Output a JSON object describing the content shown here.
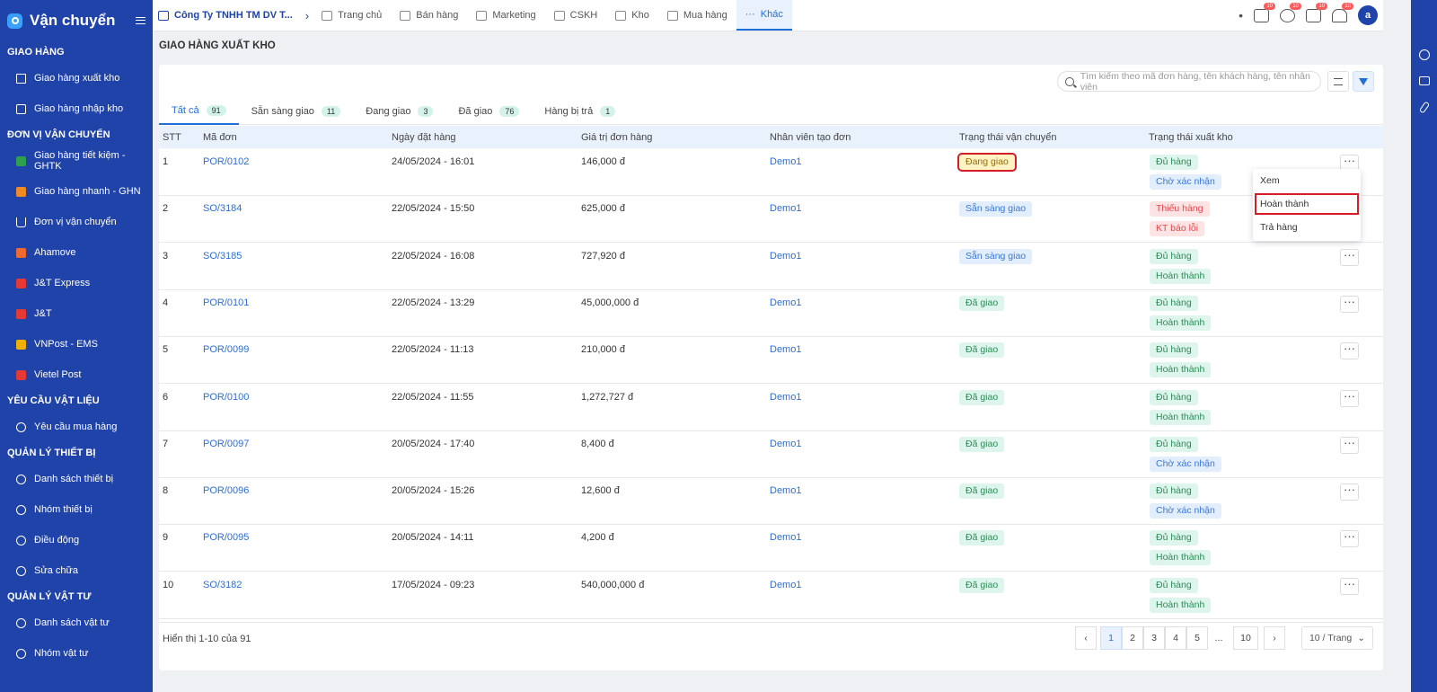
{
  "sidebar": {
    "title": "Vận chuyển",
    "sections": [
      {
        "title": "GIAO HÀNG",
        "items": [
          "Giao hàng xuất kho",
          "Giao hàng nhập kho"
        ]
      },
      {
        "title": "ĐƠN VỊ VẬN CHUYỂN",
        "items": [
          "Giao hàng tiết kiệm - GHTK",
          "Giao hàng nhanh - GHN",
          "Đơn vị vận chuyển",
          "Ahamove",
          "J&T Express",
          "J&T",
          "VNPost - EMS",
          "Vietel Post"
        ]
      },
      {
        "title": "YÊU CẦU VẬT LIỆU",
        "items": [
          "Yêu cầu mua hàng"
        ]
      },
      {
        "title": "QUẢN LÝ THIẾT BỊ",
        "items": [
          "Danh sách thiết bị",
          "Nhóm thiết bị",
          "Điều động",
          "Sửa chữa"
        ]
      },
      {
        "title": "QUẢN LÝ VẬT TƯ",
        "items": [
          "Danh sách vật tư",
          "Nhóm vật tư"
        ]
      }
    ]
  },
  "topnav": {
    "company": "Công Ty TNHH TM DV T...",
    "items": [
      "Trang chủ",
      "Bán hàng",
      "Marketing",
      "CSKH",
      "Kho",
      "Mua hàng",
      "Khác"
    ],
    "badges": [
      "10",
      "10",
      "10",
      "10",
      "10"
    ]
  },
  "page": {
    "title": "GIAO HÀNG XUẤT KHO",
    "search_placeholder": "Tìm kiếm theo mã đơn hàng, tên khách hàng, tên nhân viên"
  },
  "tabs": [
    {
      "label": "Tất cả",
      "count": "91"
    },
    {
      "label": "Sẵn sàng giao",
      "count": "11"
    },
    {
      "label": "Đang giao",
      "count": "3"
    },
    {
      "label": "Đã giao",
      "count": "76"
    },
    {
      "label": "Hàng bị trả",
      "count": "1"
    }
  ],
  "table": {
    "headers": [
      "STT",
      "Mã đơn",
      "Ngày đặt hàng",
      "Giá trị đơn hàng",
      "Nhân viên tạo đơn",
      "Trạng thái vận chuyển",
      "Trạng thái xuất kho"
    ],
    "rows": [
      {
        "stt": "1",
        "code": "POR/0102",
        "date": "24/05/2024 - 16:01",
        "value": "146,000 đ",
        "staff": "Demo1",
        "ship": "Đang giao",
        "ship_color": "yellow",
        "stock": [
          "Đủ hàng",
          "Chờ xác nhận"
        ],
        "stock_colors": [
          "green",
          "blue"
        ]
      },
      {
        "stt": "2",
        "code": "SO/3184",
        "date": "22/05/2024 - 15:50",
        "value": "625,000 đ",
        "staff": "Demo1",
        "ship": "Sẵn sàng giao",
        "ship_color": "blue",
        "stock": [
          "Thiếu hàng",
          "KT báo lỗi"
        ],
        "stock_colors": [
          "red",
          "red"
        ]
      },
      {
        "stt": "3",
        "code": "SO/3185",
        "date": "22/05/2024 - 16:08",
        "value": "727,920 đ",
        "staff": "Demo1",
        "ship": "Sẵn sàng giao",
        "ship_color": "blue",
        "stock": [
          "Đủ hàng",
          "Hoàn thành"
        ],
        "stock_colors": [
          "green",
          "green"
        ]
      },
      {
        "stt": "4",
        "code": "POR/0101",
        "date": "22/05/2024 - 13:29",
        "value": "45,000,000 đ",
        "staff": "Demo1",
        "ship": "Đã giao",
        "ship_color": "green",
        "stock": [
          "Đủ hàng",
          "Hoàn thành"
        ],
        "stock_colors": [
          "green",
          "green"
        ]
      },
      {
        "stt": "5",
        "code": "POR/0099",
        "date": "22/05/2024 - 11:13",
        "value": "210,000 đ",
        "staff": "Demo1",
        "ship": "Đã giao",
        "ship_color": "green",
        "stock": [
          "Đủ hàng",
          "Hoàn thành"
        ],
        "stock_colors": [
          "green",
          "green"
        ]
      },
      {
        "stt": "6",
        "code": "POR/0100",
        "date": "22/05/2024 - 11:55",
        "value": "1,272,727 đ",
        "staff": "Demo1",
        "ship": "Đã giao",
        "ship_color": "green",
        "stock": [
          "Đủ hàng",
          "Hoàn thành"
        ],
        "stock_colors": [
          "green",
          "green"
        ]
      },
      {
        "stt": "7",
        "code": "POR/0097",
        "date": "20/05/2024 - 17:40",
        "value": "8,400 đ",
        "staff": "Demo1",
        "ship": "Đã giao",
        "ship_color": "green",
        "stock": [
          "Đủ hàng",
          "Chờ xác nhận"
        ],
        "stock_colors": [
          "green",
          "blue"
        ]
      },
      {
        "stt": "8",
        "code": "POR/0096",
        "date": "20/05/2024 - 15:26",
        "value": "12,600 đ",
        "staff": "Demo1",
        "ship": "Đã giao",
        "ship_color": "green",
        "stock": [
          "Đủ hàng",
          "Chờ xác nhận"
        ],
        "stock_colors": [
          "green",
          "blue"
        ]
      },
      {
        "stt": "9",
        "code": "POR/0095",
        "date": "20/05/2024 - 14:11",
        "value": "4,200 đ",
        "staff": "Demo1",
        "ship": "Đã giao",
        "ship_color": "green",
        "stock": [
          "Đủ hàng",
          "Hoàn thành"
        ],
        "stock_colors": [
          "green",
          "green"
        ]
      },
      {
        "stt": "10",
        "code": "SO/3182",
        "date": "17/05/2024 - 09:23",
        "value": "540,000,000 đ",
        "staff": "Demo1",
        "ship": "Đã giao",
        "ship_color": "green",
        "stock": [
          "Đủ hàng",
          "Hoàn thành"
        ],
        "stock_colors": [
          "green",
          "green"
        ]
      }
    ]
  },
  "row_menu": [
    "Xem",
    "Hoàn thành",
    "Trả hàng"
  ],
  "footer": {
    "summary": "Hiển thị 1-10 của 91",
    "pages": [
      "1",
      "2",
      "3",
      "4",
      "5",
      "...",
      "10"
    ],
    "current_page": "1",
    "page_size": "10 / Trang"
  },
  "colors": {
    "sidebar": "#1f43a8",
    "accent": "#1f6fd8",
    "highlight": "#d41d24"
  }
}
